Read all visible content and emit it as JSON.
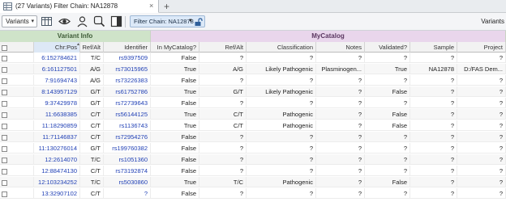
{
  "tab": {
    "label": "(27 Variants) Filter Chain: NA12878",
    "close": "×",
    "new_tab": "+"
  },
  "toolbar": {
    "source_select": "Variants",
    "filter_chain_label": "Filter Chain: NA12878",
    "right_label": "Variants"
  },
  "grid": {
    "groups": {
      "variant_info": "Variant Info",
      "mycatalog": "MyCatalog"
    },
    "columns": [
      "Chr:Pos",
      "Ref/Alt",
      "Identifier",
      "In MyCatalog?",
      "Ref/Alt",
      "Classification",
      "Notes",
      "Validated?",
      "Sample",
      "Project"
    ],
    "sorted_column": "Chr:Pos",
    "rows": [
      [
        "6:152784621",
        "T/C",
        "rs9397509",
        "False",
        "?",
        "?",
        "?",
        "?",
        "?",
        "?"
      ],
      [
        "6:161127501",
        "A/G",
        "rs73015965",
        "True",
        "A/G",
        "Likely Pathogenic",
        "Plasminogen...",
        "True",
        "NA12878",
        "D:/FAS Dem..."
      ],
      [
        "7:91694743",
        "A/G",
        "rs73226383",
        "False",
        "?",
        "?",
        "?",
        "?",
        "?",
        "?"
      ],
      [
        "8:143957129",
        "G/T",
        "rs61752786",
        "True",
        "G/T",
        "Likely Pathogenic",
        "?",
        "False",
        "?",
        "?"
      ],
      [
        "9:37429978",
        "G/T",
        "rs72739643",
        "False",
        "?",
        "?",
        "?",
        "?",
        "?",
        "?"
      ],
      [
        "11:6638385",
        "C/T",
        "rs56144125",
        "True",
        "C/T",
        "Pathogenic",
        "?",
        "False",
        "?",
        "?"
      ],
      [
        "11:18290859",
        "C/T",
        "rs1136743",
        "True",
        "C/T",
        "Pathogenic",
        "?",
        "False",
        "?",
        "?"
      ],
      [
        "11:71146837",
        "C/T",
        "rs72954276",
        "False",
        "?",
        "?",
        "?",
        "?",
        "?",
        "?"
      ],
      [
        "11:130276014",
        "G/T",
        "rs199760382",
        "False",
        "?",
        "?",
        "?",
        "?",
        "?",
        "?"
      ],
      [
        "12:2614070",
        "T/C",
        "rs1051360",
        "False",
        "?",
        "?",
        "?",
        "?",
        "?",
        "?"
      ],
      [
        "12:88474130",
        "C/T",
        "rs73192874",
        "False",
        "?",
        "?",
        "?",
        "?",
        "?",
        "?"
      ],
      [
        "12:103234252",
        "T/C",
        "rs5030860",
        "True",
        "T/C",
        "Pathogenic",
        "?",
        "False",
        "?",
        "?"
      ],
      [
        "13:32907102",
        "C/T",
        "?",
        "False",
        "?",
        "?",
        "?",
        "?",
        "?",
        "?"
      ]
    ]
  }
}
